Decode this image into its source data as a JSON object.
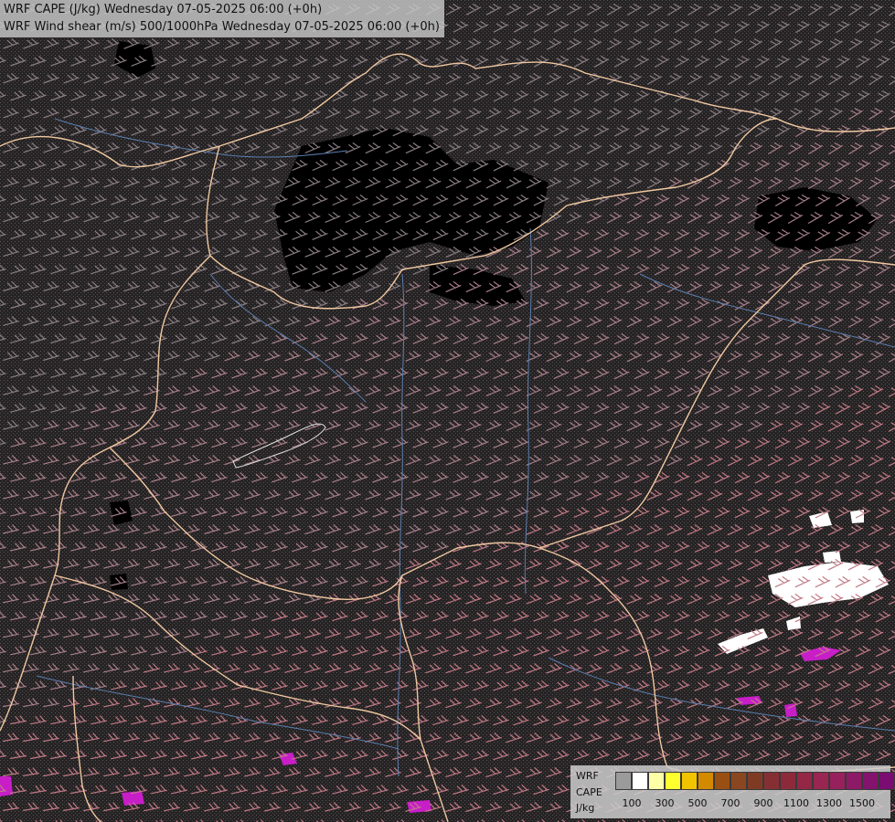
{
  "title": {
    "line1": "WRF CAPE (J/kg) Wednesday 07-05-2025 06:00 (+0h)",
    "line2": "WRF Wind shear (m/s) 500/1000hPa Wednesday 07-05-2025 06:00 (+0h)"
  },
  "legend": {
    "title_lines": [
      "WRF",
      "CAPE",
      "J/kg"
    ],
    "swatches": [
      "#9b9b9b",
      "#ffffff",
      "#ffffa8",
      "#ffff30",
      "#f2c400",
      "#d48a00",
      "#9a4f12",
      "#8a4620",
      "#7f3a24",
      "#862f33",
      "#8c2a3c",
      "#942746",
      "#992650",
      "#96215c",
      "#8d1a66",
      "#84136d",
      "#7a0c72"
    ],
    "tick_labels": [
      "100",
      "300",
      "500",
      "700",
      "900",
      "1100",
      "1300",
      "1500"
    ]
  },
  "colors": {
    "background": "#2a2728",
    "border": "#f0c8a0",
    "river": "#5a7fb0",
    "low_cape": "#000000",
    "white_cape": "#ffffff",
    "magenta_cape": "#c81ec8"
  }
}
